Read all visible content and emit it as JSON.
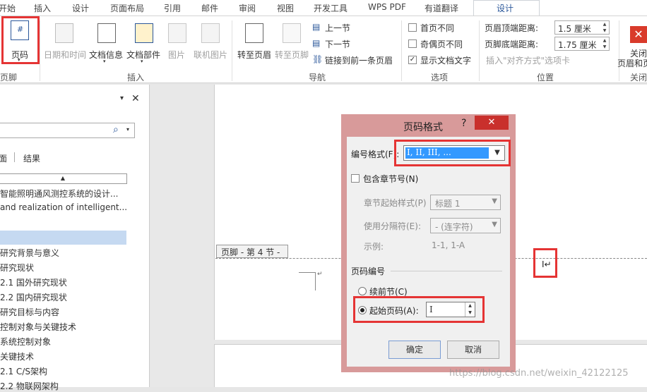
{
  "tabs": [
    "开始",
    "插入",
    "设计",
    "页面布局",
    "引用",
    "邮件",
    "审阅",
    "视图",
    "开发工具",
    "WPS PDF",
    "有道翻译",
    "设计"
  ],
  "ribbon": {
    "page_number": "页码",
    "header_footer_group": "页脚",
    "date_time": "日期和时间",
    "doc_info": "文档信息",
    "doc_parts": "文档部件",
    "picture": "图片",
    "online_picture": "联机图片",
    "insert_group": "插入",
    "goto_header": "转至页眉",
    "goto_footer": "转至页脚",
    "prev_section": "上一节",
    "next_section": "下一节",
    "link_prev": "链接到前一条页眉",
    "nav_group": "导航",
    "first_page_diff": "首页不同",
    "odd_even_diff": "奇偶页不同",
    "show_doc_text": "显示文档文字",
    "options_group": "选项",
    "header_top_label": "页眉顶端距离:",
    "header_top_value": "1.5 厘米",
    "footer_bottom_label": "页脚底端距离:",
    "footer_bottom_value": "1.75 厘米",
    "insert_align_tab": "插入\"对齐方式\"选项卡",
    "position_group": "位置",
    "close_label_1": "关闭",
    "close_label_2": "页眉和页",
    "close_group": "关闭"
  },
  "sidebar": {
    "search_glyph": "⌕",
    "tab_pages": "面",
    "tab_results": "结果",
    "items": [
      "智能照明通风测控系统的设计...",
      "and realization of intelligent...",
      "",
      "研究背景与意义",
      "研究现状",
      "2.1 国外研究现状",
      "2.2 国内研究现状",
      "研究目标与内容",
      "控制对象与关键技术",
      "系统控制对象",
      "关键技术",
      "2.1 C/S架构",
      "2.2 物联网架构"
    ]
  },
  "document": {
    "footer_tag": "页脚 - 第 4 节 -",
    "cursor_text": "I↵"
  },
  "dialog": {
    "title": "页码格式",
    "help": "?",
    "close": "✕",
    "format_label": "编号格式(F):",
    "format_value": "I, II, III, ...",
    "include_chapter": "包含章节号(N)",
    "chapter_style_label": "章节起始样式(P)",
    "chapter_style_value": "标题 1",
    "separator_label": "使用分隔符(E):",
    "separator_value": "-  (连字符)",
    "example_label": "示例:",
    "example_value": "1-1, 1-A",
    "numbering_group": "页码编号",
    "continue_prev": "续前节(C)",
    "start_at": "起始页码(A):",
    "start_value": "I",
    "ok": "确定",
    "cancel": "取消"
  },
  "watermark": "https://blog.csdn.net/weixin_42122125"
}
